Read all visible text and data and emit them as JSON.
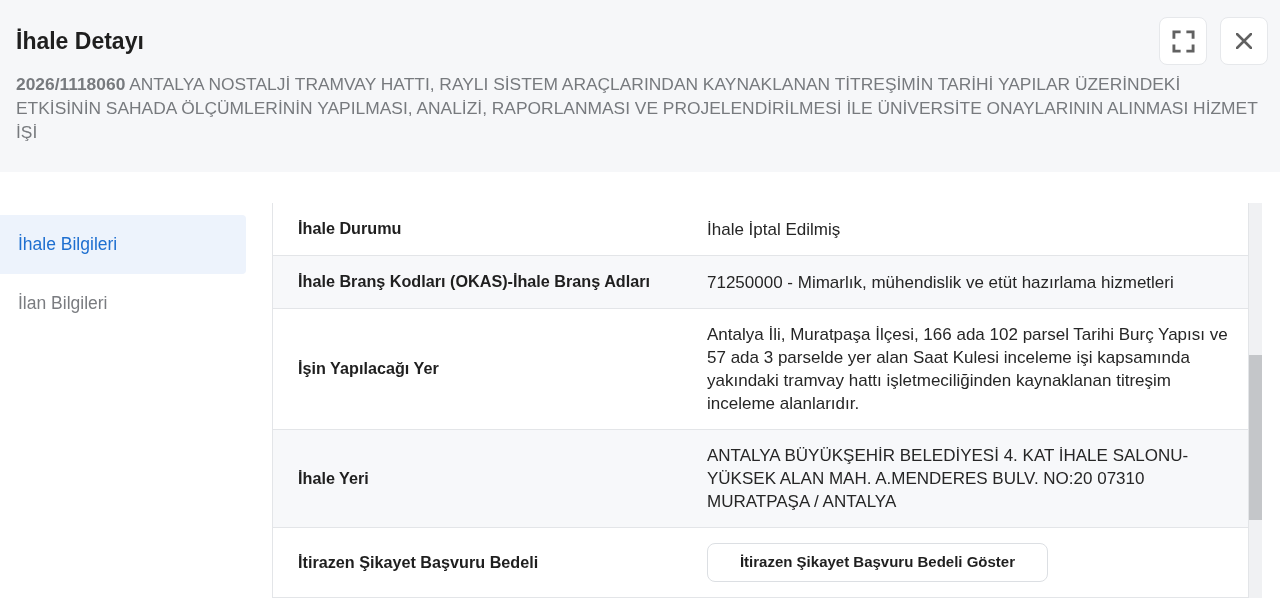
{
  "header": {
    "title": "İhale Detayı",
    "description": "**2026/1118060** ANTALYA NOSTALJİ TRAMVAY HATTI, RAYLI SİSTEM ARAÇLARINDAN KAYNAKLANAN TİTREŞİMİN TARİHİ YAPILAR ÜZERİNDEKİ ETKİSİNİN SAHADA ÖLÇÜMLERİNİN YAPILMASI, ANALİZİ, RAPORLANMASI VE PROJELENDİRİLMESİ İLE ÜNİVERSİTE ONAYLARININ ALINMASI HİZMET İŞİ"
  },
  "sidebar": {
    "tabs": [
      {
        "label": "İhale Bilgileri",
        "selected": true
      },
      {
        "label": "İlan Bilgileri",
        "selected": false
      }
    ]
  },
  "details": {
    "rows": [
      {
        "kind": "text",
        "label": "İhale Durumu",
        "value": "İhale İptal Edilmiş"
      },
      {
        "kind": "text",
        "label": "İhale Branş Kodları (OKAS)-İhale Branş Adları",
        "value": "71250000 - Mimarlık, mühendislik ve etüt hazırlama hizmetleri"
      },
      {
        "kind": "text",
        "label": "İşin Yapılacağı Yer",
        "value": "Antalya İli, Muratpaşa İlçesi, 166 ada 102 parsel Tarihi Burç Yapısı ve 57 ada 3 parselde yer alan Saat Kulesi inceleme işi kapsamında yakındaki tramvay hattı işletmeciliğinden kaynaklanan titreşim inceleme alanlarıdır."
      },
      {
        "kind": "text",
        "label": "İhale Yeri",
        "value": "ANTALYA BÜYÜKŞEHİR BELEDİYESİ 4. KAT İHALE SALONU-YÜKSEK ALAN MAH. A.MENDERES BULV. NO:20 07310 MURATPAŞA / ANTALYA"
      },
      {
        "kind": "button",
        "label": "İtirazen Şikayet Başvuru Bedeli",
        "button": "İtirazen Şikayet Başvuru Bedeli Göster"
      }
    ]
  }
}
